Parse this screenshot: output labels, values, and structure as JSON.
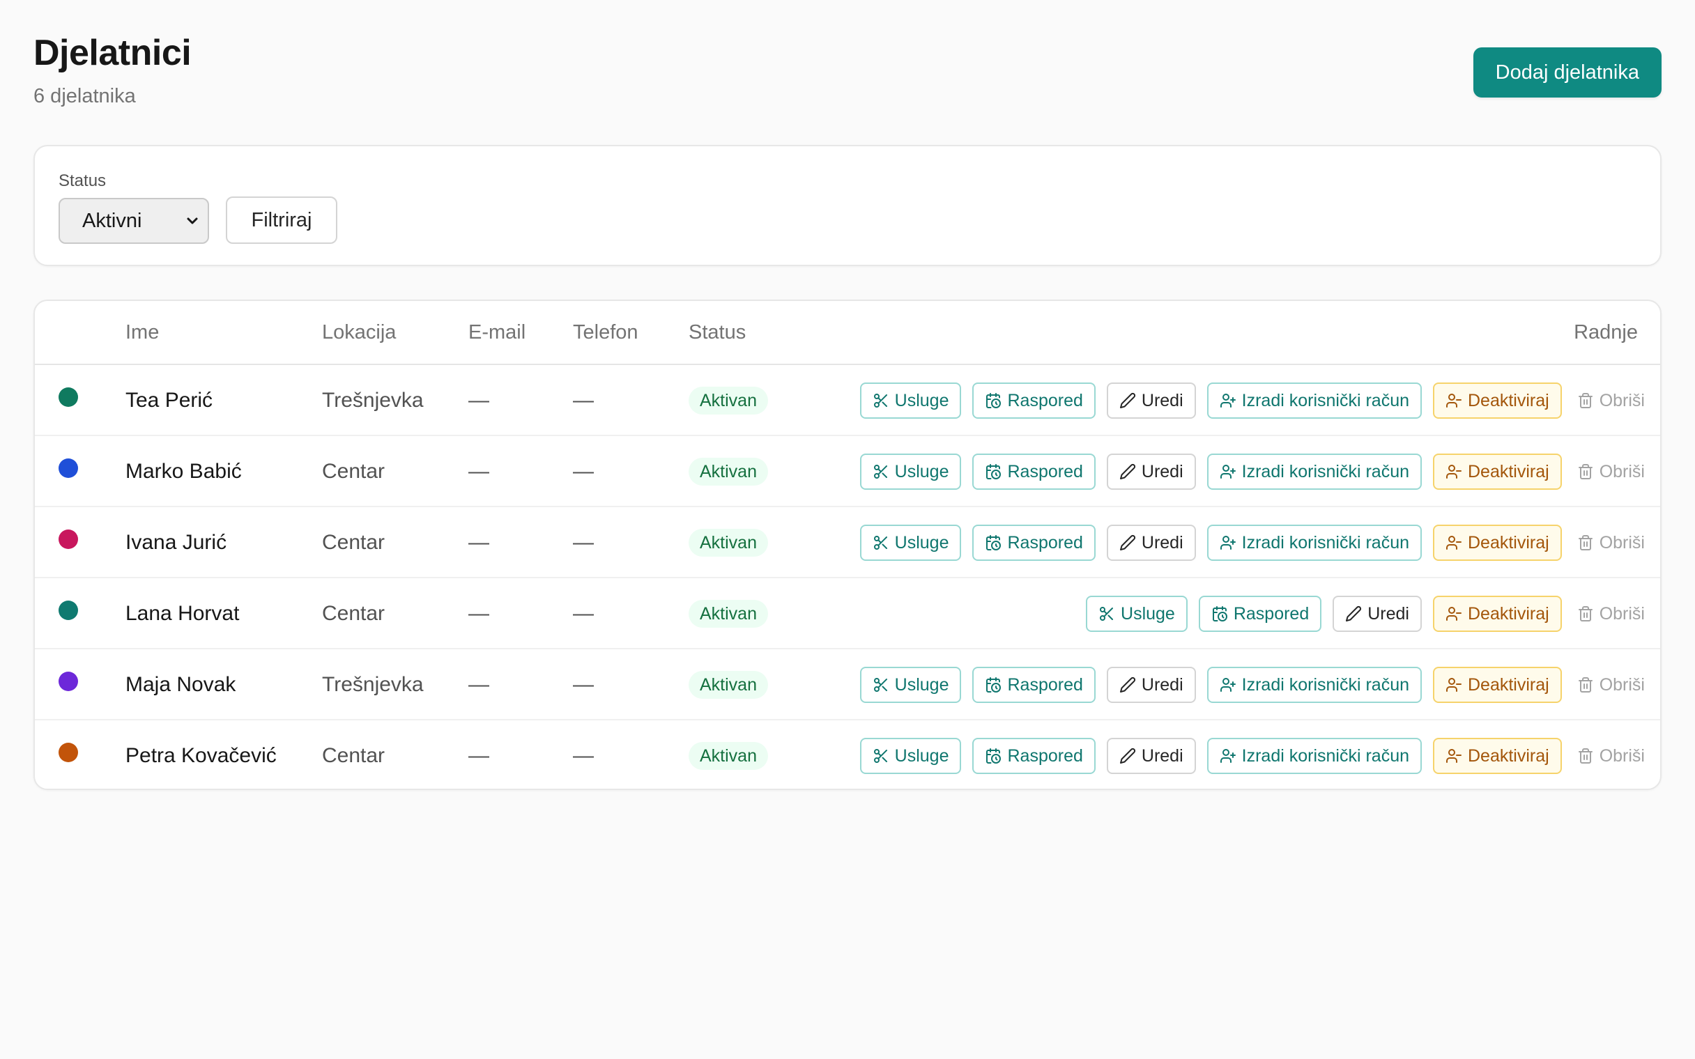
{
  "header": {
    "title": "Djelatnici",
    "subtitle": "6 djelatnika",
    "add_button_label": "Dodaj djelatnika"
  },
  "filter": {
    "status_label": "Status",
    "status_value": "Aktivni",
    "filter_button_label": "Filtriraj"
  },
  "table": {
    "columns": {
      "name": "Ime",
      "location": "Lokacija",
      "email": "E-mail",
      "phone": "Telefon",
      "status": "Status",
      "actions": "Radnje"
    },
    "action_labels": {
      "services": "Usluge",
      "schedule": "Raspored",
      "edit": "Uredi",
      "create_account": "Izradi korisnički račun",
      "deactivate": "Deaktiviraj",
      "delete": "Obriši"
    },
    "rows": [
      {
        "color": "#0f7a5f",
        "name": "Tea Perić",
        "location": "Trešnjevka",
        "email": "—",
        "phone": "—",
        "status": "Aktivan",
        "has_account_action": true
      },
      {
        "color": "#1f4fd8",
        "name": "Marko Babić",
        "location": "Centar",
        "email": "—",
        "phone": "—",
        "status": "Aktivan",
        "has_account_action": true
      },
      {
        "color": "#c8175d",
        "name": "Ivana Jurić",
        "location": "Centar",
        "email": "—",
        "phone": "—",
        "status": "Aktivan",
        "has_account_action": true
      },
      {
        "color": "#0f7a70",
        "name": "Lana Horvat",
        "location": "Centar",
        "email": "—",
        "phone": "—",
        "status": "Aktivan",
        "has_account_action": false
      },
      {
        "color": "#6d28d9",
        "name": "Maja Novak",
        "location": "Trešnjevka",
        "email": "—",
        "phone": "—",
        "status": "Aktivan",
        "has_account_action": true
      },
      {
        "color": "#c2540a",
        "name": "Petra Kovačević",
        "location": "Centar",
        "email": "—",
        "phone": "—",
        "status": "Aktivan",
        "has_account_action": true
      }
    ]
  },
  "colors": {
    "primary": "#0f8a82",
    "badge_bg": "#ecfdf3",
    "badge_text": "#15703f",
    "deactivate": "#a3560b"
  }
}
